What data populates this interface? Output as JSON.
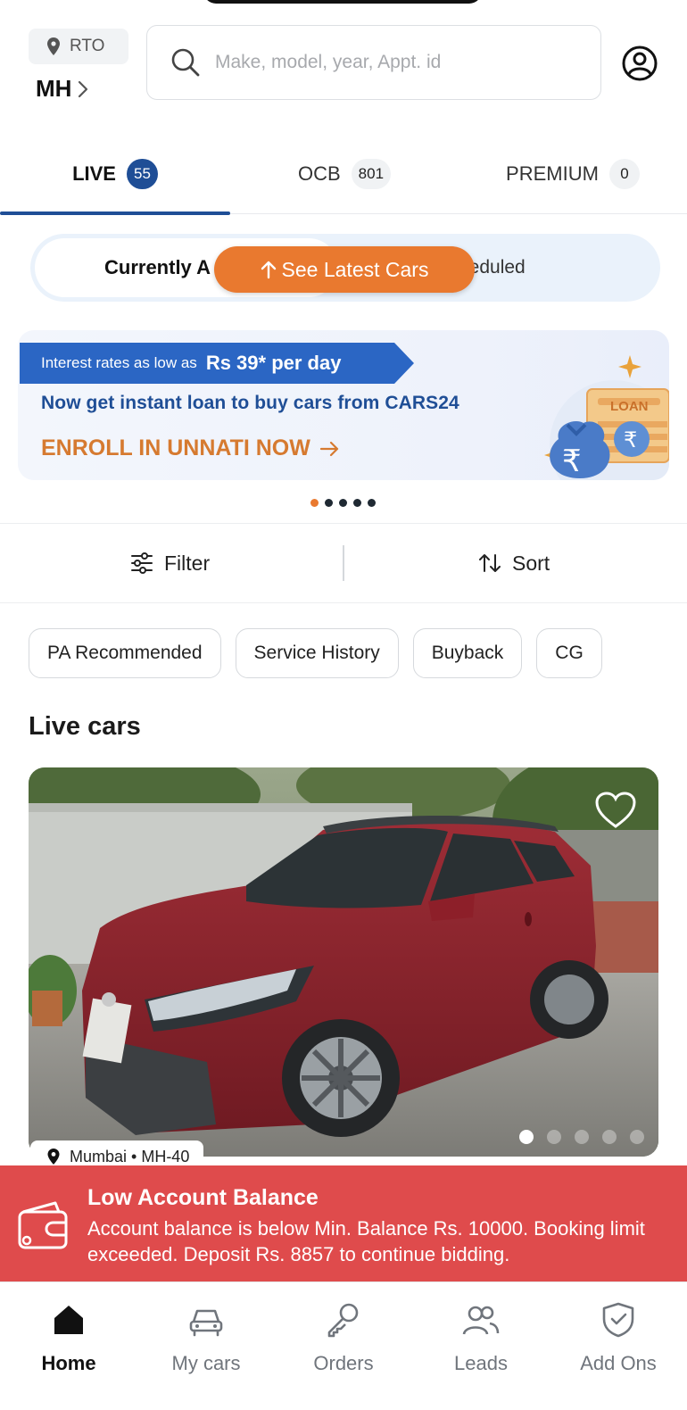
{
  "header": {
    "rto_label": "RTO",
    "state_code": "MH",
    "search_placeholder": "Make, model, year, Appt. id"
  },
  "tabs": [
    {
      "label": "LIVE",
      "count": "55",
      "active": true
    },
    {
      "label": "OCB",
      "count": "801",
      "active": false
    },
    {
      "label": "PREMIUM",
      "count": "0",
      "active": false
    }
  ],
  "segment": {
    "active_label": "Currently A",
    "right_label": "heduled",
    "latest_button": "See Latest Cars"
  },
  "banner": {
    "ribbon_small": "Interest rates as low as",
    "ribbon_big": "Rs 39* per day",
    "line2": "Now get instant loan to buy cars from CARS24",
    "cta": "ENROLL IN UNNATI NOW",
    "art_label": "LOAN"
  },
  "carousel": {
    "total": 5,
    "active_index": 0
  },
  "toolbar": {
    "filter_label": "Filter",
    "sort_label": "Sort"
  },
  "chips": [
    "PA Recommended",
    "Service History",
    "Buyback",
    "CG"
  ],
  "section_title": "Live cars",
  "car_card": {
    "location": "Mumbai • MH-40",
    "image_total": 5,
    "image_active_index": 0
  },
  "alert": {
    "title": "Low Account Balance",
    "message": "Account balance is below Min. Balance Rs. 10000. Booking limit exceeded. Deposit Rs. 8857 to continue bidding."
  },
  "bottom_nav": [
    {
      "label": "Home",
      "icon": "home-icon",
      "active": true
    },
    {
      "label": "My cars",
      "icon": "car-icon",
      "active": false
    },
    {
      "label": "Orders",
      "icon": "key-icon",
      "active": false
    },
    {
      "label": "Leads",
      "icon": "people-icon",
      "active": false
    },
    {
      "label": "Add Ons",
      "icon": "shield-check-icon",
      "active": false
    }
  ],
  "colors": {
    "brand_blue": "#1f4e96",
    "accent_orange": "#e9792f",
    "alert_red": "#df4b4c",
    "banner_blue": "#2b66c4"
  }
}
